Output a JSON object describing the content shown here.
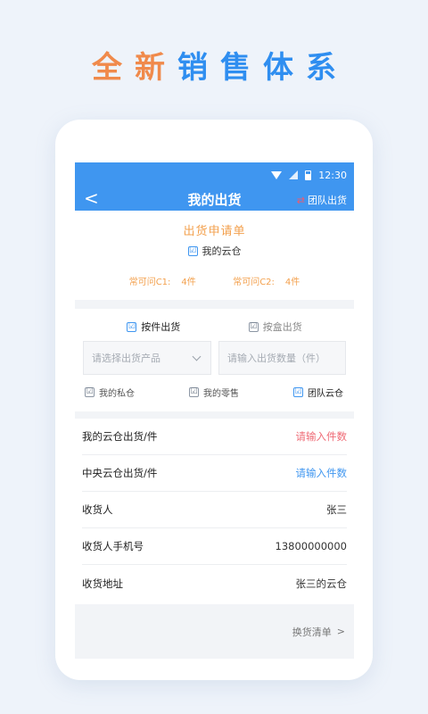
{
  "headline": {
    "w1": "全",
    "w2": "新",
    "w3": "销",
    "w4": "售",
    "w5": "体",
    "w6": "系"
  },
  "status": {
    "time": "12:30"
  },
  "nav": {
    "back": "<",
    "title": "我的出货",
    "swap_icon": "⇄",
    "right": "团队出货"
  },
  "request": {
    "title": "出货申请单",
    "cb": "☑",
    "checkbox_label": "我的云仓"
  },
  "stock": [
    {
      "label": "常可问C1:",
      "value": "4件"
    },
    {
      "label": "常可问C2:",
      "value": "4件"
    }
  ],
  "ship_modes": {
    "by_piece": "按件出货",
    "by_box": "按盒出货"
  },
  "inputs": {
    "product_placeholder": "请选择出货产品",
    "qty_placeholder": "请输入出货数量（件）"
  },
  "warehouses": {
    "private": "我的私仓",
    "retail": "我的零售",
    "team": "团队云仓"
  },
  "rows": [
    {
      "label": "我的云仓出货/件",
      "value": "请输入件数"
    },
    {
      "label": "中央云仓出货/件",
      "value": "请输入件数"
    },
    {
      "label": "收货人",
      "value": "张三"
    },
    {
      "label": "收货人手机号",
      "value": "13800000000"
    },
    {
      "label": "收货地址",
      "value": "张三的云仓"
    }
  ],
  "footer": {
    "link": "换货清单",
    "arrow": ">"
  },
  "colors": {
    "accent": "#3f96f0",
    "orange": "#f3a04d",
    "red": "#ef6b76"
  }
}
